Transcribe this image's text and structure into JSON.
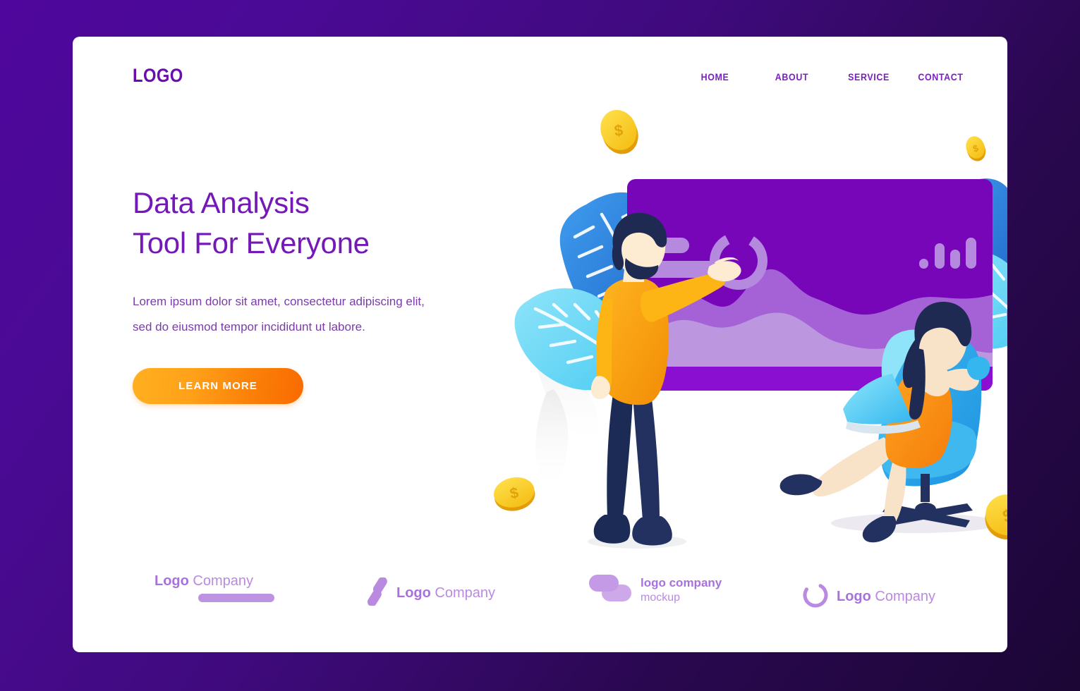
{
  "page": {
    "background_gradient": [
      "#4e069c",
      "#1b0635"
    ],
    "card_bg": "#ffffff"
  },
  "header": {
    "logo": "LOGO",
    "logo_color": "#6a0dab",
    "nav": [
      {
        "label": "HOME",
        "name": "nav-home"
      },
      {
        "label": "ABOUT",
        "name": "nav-about"
      },
      {
        "label": "SERVICE",
        "name": "nav-service"
      },
      {
        "label": "CONTACT",
        "name": "nav-contact"
      }
    ]
  },
  "hero": {
    "headline": "Data Analysis\nTool For Everyone",
    "headline_color": "#7518b8",
    "subcopy": "Lorem ipsum dolor sit amet, consectetur adipiscing elit, sed do eiusmod tempor incididunt ut labore.",
    "subcopy_color": "#7a3da8",
    "cta_label": "LEARN MORE",
    "cta_gradient": [
      "#ffb01f",
      "#f96a00"
    ]
  },
  "illustration": {
    "screen": {
      "bg_color": "#7606b8",
      "bar_color": "#8a0fd1",
      "widgets": [
        {
          "name": "bar-short",
          "type": "rounded-bar"
        },
        {
          "name": "bar-long",
          "type": "rounded-bar"
        },
        {
          "name": "donut-chart",
          "type": "ring"
        },
        {
          "name": "mini-bar-chart",
          "type": "bars",
          "bar_count": 4
        }
      ],
      "area_chart": {
        "back_wave_color": "#a561d6",
        "front_wave_color": "#bd96e0"
      }
    },
    "characters": [
      {
        "name": "man-presenting",
        "shirt_color": "#f99d0b",
        "pants_color": "#22315f"
      },
      {
        "name": "woman-in-chair",
        "dress_color": "#f7931e",
        "chair_color": "#29a9e8"
      }
    ],
    "coins": [
      {
        "name": "coin-top-left",
        "symbol": "$"
      },
      {
        "name": "coin-top-right",
        "symbol": "$"
      },
      {
        "name": "coin-bottom-left",
        "symbol": "$"
      },
      {
        "name": "coin-bottom-right",
        "symbol": "$"
      }
    ],
    "leaves": [
      {
        "name": "leaf-banana-blue-left",
        "color": "#2f8ae8"
      },
      {
        "name": "leaf-monstera-cyan-left",
        "color": "#6fd8f5"
      },
      {
        "name": "leaf-banana-blue-right",
        "color": "#2f8ae8"
      },
      {
        "name": "leaf-monstera-cyan-right",
        "color": "#6fd8f5"
      }
    ]
  },
  "brands": [
    {
      "name": "brand-logo-company-bar",
      "bold": "Logo",
      "light": " Company",
      "underline": true
    },
    {
      "name": "brand-logo-company-slashes",
      "bold": "Logo",
      "light": " Company"
    },
    {
      "name": "brand-logo-company-mockup",
      "line1": "logo company",
      "line2": "mockup"
    },
    {
      "name": "brand-logo-company-circle",
      "bold": "Logo",
      "light": " Company"
    }
  ]
}
